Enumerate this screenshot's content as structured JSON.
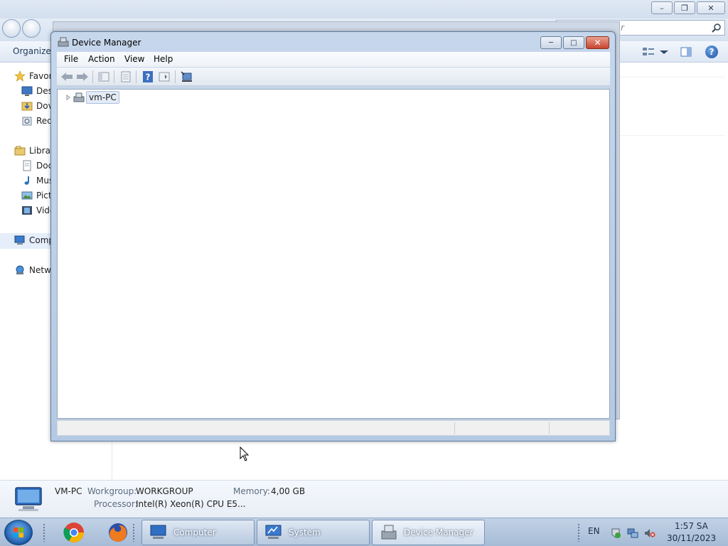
{
  "explorer": {
    "search_placeholder": "r",
    "organize_label": "Organize",
    "help_glyph": "?",
    "nav": {
      "favorites": "Favor",
      "desktop": "Des",
      "downloads": "Dov",
      "recent": "Rec",
      "libraries": "Librar",
      "documents": "Doc",
      "music": "Mus",
      "pictures": "Pict",
      "videos": "Vide",
      "computer": "Comp",
      "network": "Netwo"
    },
    "details": {
      "name": "VM-PC",
      "workgroup_label": "Workgroup:",
      "workgroup_value": "WORKGROUP",
      "memory_label": "Memory:",
      "memory_value": "4,00 GB",
      "processor_label": "Processor:",
      "processor_value": "Intel(R) Xeon(R) CPU E5..."
    }
  },
  "device_manager": {
    "title": "Device Manager",
    "menu": [
      "File",
      "Action",
      "View",
      "Help"
    ],
    "tree_root": "vm-PC"
  },
  "taskbar": {
    "tasks": [
      "Computer",
      "System",
      "Device Manager"
    ],
    "language": "EN",
    "time": "1:57 SA",
    "date": "30/11/2023"
  },
  "colors": {
    "accent": "#1e5fad",
    "close_red": "#c84530",
    "taskbar": "#a6bbd6"
  }
}
